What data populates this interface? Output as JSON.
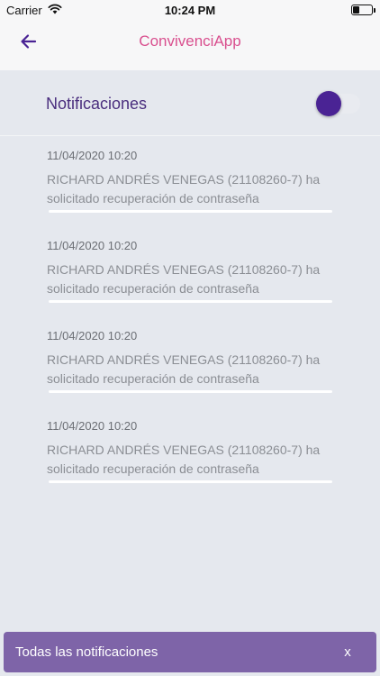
{
  "status_bar": {
    "carrier": "Carrier",
    "time": "10:24 PM",
    "battery_level": 0.35
  },
  "header": {
    "title": "ConvivenciApp",
    "back_icon": "arrow-left-icon",
    "title_color": "#d9508f"
  },
  "notifications_toggle": {
    "label": "Notificaciones",
    "enabled": true,
    "accent": "#4a2394"
  },
  "notifications": [
    {
      "date": "11/04/2020 10:20",
      "message": "RICHARD ANDRÉS  VENEGAS (21108260-7) ha solicitado recuperación de contraseña"
    },
    {
      "date": "11/04/2020 10:20",
      "message": "RICHARD ANDRÉS  VENEGAS (21108260-7) ha solicitado recuperación de contraseña"
    },
    {
      "date": "11/04/2020 10:20",
      "message": "RICHARD ANDRÉS  VENEGAS (21108260-7) ha solicitado recuperación de contraseña"
    },
    {
      "date": "11/04/2020 10:20",
      "message": "RICHARD ANDRÉS  VENEGAS (21108260-7) ha solicitado recuperación de contraseña"
    }
  ],
  "footer": {
    "label": "Todas las notificaciones",
    "close_label": "x",
    "background": "#7e64a8"
  }
}
